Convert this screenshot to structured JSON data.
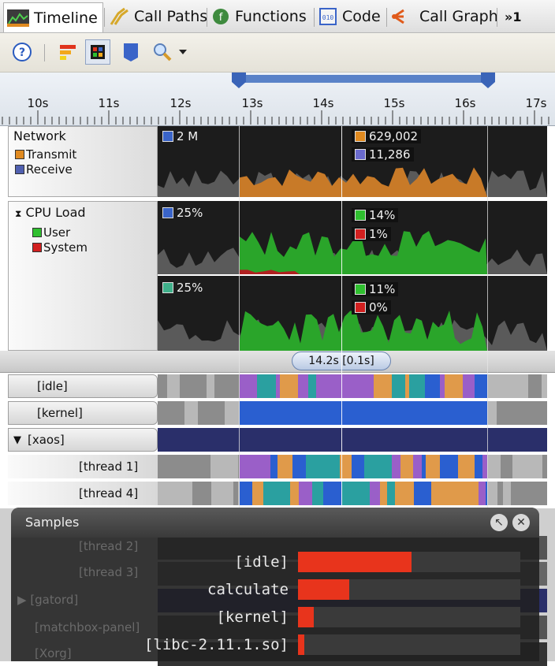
{
  "tabs": [
    {
      "label": "Timeline",
      "icon": "timeline-icon",
      "active": true
    },
    {
      "label": "Call Paths",
      "icon": "call-paths-icon"
    },
    {
      "label": "Functions",
      "icon": "functions-icon"
    },
    {
      "label": "Code",
      "icon": "code-icon"
    },
    {
      "label": "Call Graph",
      "icon": "call-graph-icon"
    }
  ],
  "tab_overflow": "»1",
  "toolbar": {
    "buttons": [
      "help-icon",
      "color-bars-icon",
      "chip-icon",
      "bookmark-icon",
      "zoom-icon",
      "dropdown-arrow-icon"
    ]
  },
  "ruler": {
    "ticks": [
      "10s",
      "11s",
      "12s",
      "13s",
      "14s",
      "15s",
      "16s",
      "17s"
    ],
    "selection_start": "13s",
    "selection_end": "16.3s"
  },
  "network": {
    "title": "Network",
    "legend": [
      {
        "label": "Transmit",
        "color": "#e08a20"
      },
      {
        "label": "Receive",
        "color": "#5060b0"
      }
    ],
    "scale_label": "2 M",
    "scale_color": "#3a64c8",
    "values": [
      {
        "text": "629,002",
        "color": "#e08a20"
      },
      {
        "text": "11,286",
        "color": "#6a6acc"
      }
    ]
  },
  "cpu": {
    "title": "CPU Load",
    "legend": [
      {
        "label": "User",
        "color": "#2fbf2f"
      },
      {
        "label": "System",
        "color": "#d22020"
      }
    ],
    "core1": {
      "scale_label": "25%",
      "scale_color": "#3a64c8",
      "values": [
        {
          "text": "14%",
          "color": "#2fbf2f"
        },
        {
          "text": "1%",
          "color": "#d22020"
        }
      ]
    },
    "core2": {
      "scale_label": "25%",
      "scale_color": "#3fb08a",
      "values": [
        {
          "text": "11%",
          "color": "#2fbf2f"
        },
        {
          "text": "0%",
          "color": "#d22020"
        }
      ]
    }
  },
  "cursor_time": "14.2s [0.1s]",
  "processes": [
    {
      "label": "[idle]"
    },
    {
      "label": "[kernel]"
    },
    {
      "label": "[xaos]"
    },
    {
      "label": "[thread 1]"
    },
    {
      "label": "[thread 4]"
    },
    {
      "label": "[thread 2]"
    },
    {
      "label": "[thread 3]"
    },
    {
      "label": "[gatord]"
    },
    {
      "label": "[matchbox-panel]"
    },
    {
      "label": "[Xorg]"
    }
  ],
  "samples": {
    "title": "Samples",
    "rows": [
      {
        "name": "[idle]",
        "fraction": 0.51
      },
      {
        "name": "calculate",
        "fraction": 0.23
      },
      {
        "name": "[kernel]",
        "fraction": 0.07
      },
      {
        "name": "[libc-2.11.1.so]",
        "fraction": 0.03
      }
    ]
  }
}
